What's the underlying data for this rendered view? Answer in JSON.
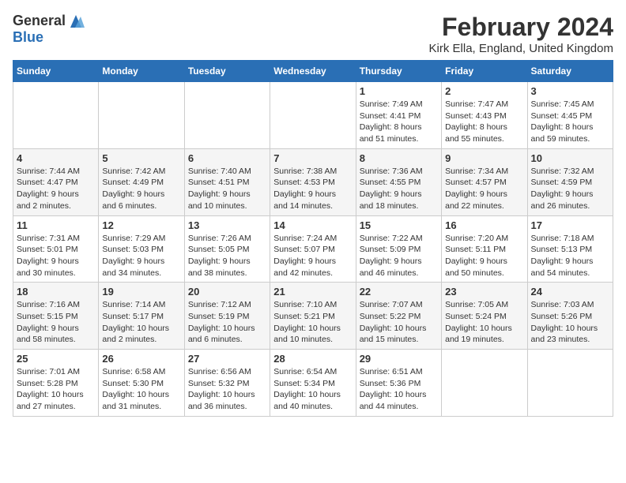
{
  "logo": {
    "general": "General",
    "blue": "Blue"
  },
  "title": {
    "month_year": "February 2024",
    "location": "Kirk Ella, England, United Kingdom"
  },
  "headers": [
    "Sunday",
    "Monday",
    "Tuesday",
    "Wednesday",
    "Thursday",
    "Friday",
    "Saturday"
  ],
  "weeks": [
    [
      {
        "day": "",
        "info": ""
      },
      {
        "day": "",
        "info": ""
      },
      {
        "day": "",
        "info": ""
      },
      {
        "day": "",
        "info": ""
      },
      {
        "day": "1",
        "info": "Sunrise: 7:49 AM\nSunset: 4:41 PM\nDaylight: 8 hours\nand 51 minutes."
      },
      {
        "day": "2",
        "info": "Sunrise: 7:47 AM\nSunset: 4:43 PM\nDaylight: 8 hours\nand 55 minutes."
      },
      {
        "day": "3",
        "info": "Sunrise: 7:45 AM\nSunset: 4:45 PM\nDaylight: 8 hours\nand 59 minutes."
      }
    ],
    [
      {
        "day": "4",
        "info": "Sunrise: 7:44 AM\nSunset: 4:47 PM\nDaylight: 9 hours\nand 2 minutes."
      },
      {
        "day": "5",
        "info": "Sunrise: 7:42 AM\nSunset: 4:49 PM\nDaylight: 9 hours\nand 6 minutes."
      },
      {
        "day": "6",
        "info": "Sunrise: 7:40 AM\nSunset: 4:51 PM\nDaylight: 9 hours\nand 10 minutes."
      },
      {
        "day": "7",
        "info": "Sunrise: 7:38 AM\nSunset: 4:53 PM\nDaylight: 9 hours\nand 14 minutes."
      },
      {
        "day": "8",
        "info": "Sunrise: 7:36 AM\nSunset: 4:55 PM\nDaylight: 9 hours\nand 18 minutes."
      },
      {
        "day": "9",
        "info": "Sunrise: 7:34 AM\nSunset: 4:57 PM\nDaylight: 9 hours\nand 22 minutes."
      },
      {
        "day": "10",
        "info": "Sunrise: 7:32 AM\nSunset: 4:59 PM\nDaylight: 9 hours\nand 26 minutes."
      }
    ],
    [
      {
        "day": "11",
        "info": "Sunrise: 7:31 AM\nSunset: 5:01 PM\nDaylight: 9 hours\nand 30 minutes."
      },
      {
        "day": "12",
        "info": "Sunrise: 7:29 AM\nSunset: 5:03 PM\nDaylight: 9 hours\nand 34 minutes."
      },
      {
        "day": "13",
        "info": "Sunrise: 7:26 AM\nSunset: 5:05 PM\nDaylight: 9 hours\nand 38 minutes."
      },
      {
        "day": "14",
        "info": "Sunrise: 7:24 AM\nSunset: 5:07 PM\nDaylight: 9 hours\nand 42 minutes."
      },
      {
        "day": "15",
        "info": "Sunrise: 7:22 AM\nSunset: 5:09 PM\nDaylight: 9 hours\nand 46 minutes."
      },
      {
        "day": "16",
        "info": "Sunrise: 7:20 AM\nSunset: 5:11 PM\nDaylight: 9 hours\nand 50 minutes."
      },
      {
        "day": "17",
        "info": "Sunrise: 7:18 AM\nSunset: 5:13 PM\nDaylight: 9 hours\nand 54 minutes."
      }
    ],
    [
      {
        "day": "18",
        "info": "Sunrise: 7:16 AM\nSunset: 5:15 PM\nDaylight: 9 hours\nand 58 minutes."
      },
      {
        "day": "19",
        "info": "Sunrise: 7:14 AM\nSunset: 5:17 PM\nDaylight: 10 hours\nand 2 minutes."
      },
      {
        "day": "20",
        "info": "Sunrise: 7:12 AM\nSunset: 5:19 PM\nDaylight: 10 hours\nand 6 minutes."
      },
      {
        "day": "21",
        "info": "Sunrise: 7:10 AM\nSunset: 5:21 PM\nDaylight: 10 hours\nand 10 minutes."
      },
      {
        "day": "22",
        "info": "Sunrise: 7:07 AM\nSunset: 5:22 PM\nDaylight: 10 hours\nand 15 minutes."
      },
      {
        "day": "23",
        "info": "Sunrise: 7:05 AM\nSunset: 5:24 PM\nDaylight: 10 hours\nand 19 minutes."
      },
      {
        "day": "24",
        "info": "Sunrise: 7:03 AM\nSunset: 5:26 PM\nDaylight: 10 hours\nand 23 minutes."
      }
    ],
    [
      {
        "day": "25",
        "info": "Sunrise: 7:01 AM\nSunset: 5:28 PM\nDaylight: 10 hours\nand 27 minutes."
      },
      {
        "day": "26",
        "info": "Sunrise: 6:58 AM\nSunset: 5:30 PM\nDaylight: 10 hours\nand 31 minutes."
      },
      {
        "day": "27",
        "info": "Sunrise: 6:56 AM\nSunset: 5:32 PM\nDaylight: 10 hours\nand 36 minutes."
      },
      {
        "day": "28",
        "info": "Sunrise: 6:54 AM\nSunset: 5:34 PM\nDaylight: 10 hours\nand 40 minutes."
      },
      {
        "day": "29",
        "info": "Sunrise: 6:51 AM\nSunset: 5:36 PM\nDaylight: 10 hours\nand 44 minutes."
      },
      {
        "day": "",
        "info": ""
      },
      {
        "day": "",
        "info": ""
      }
    ]
  ]
}
